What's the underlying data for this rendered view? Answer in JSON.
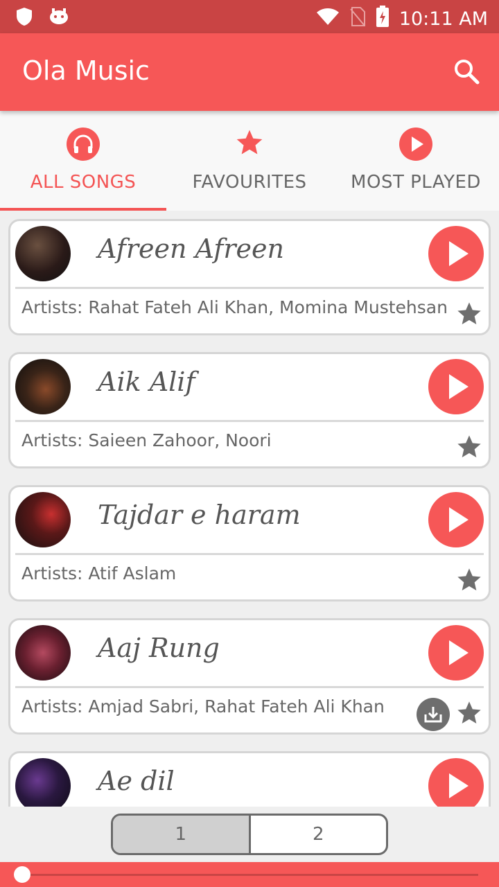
{
  "status": {
    "time": "10:11 AM"
  },
  "app": {
    "title": "Ola Music"
  },
  "tabs": [
    {
      "label": "ALL SONGS",
      "icon": "headphones-icon",
      "active": true
    },
    {
      "label": "FAVOURITES",
      "icon": "star-icon",
      "active": false
    },
    {
      "label": "MOST PLAYED",
      "icon": "play-circle-icon",
      "active": false
    }
  ],
  "songs": [
    {
      "title": "Afreen Afreen",
      "artists": "Artists: Rahat Fateh Ali Khan, Momina Mustehsan",
      "downloadable": false
    },
    {
      "title": "Aik Alif",
      "artists": "Artists: Saieen Zahoor, Noori",
      "downloadable": false
    },
    {
      "title": "Tajdar e haram",
      "artists": "Artists: Atif Aslam",
      "downloadable": false
    },
    {
      "title": "Aaj Rung",
      "artists": "Artists: Amjad Sabri,  Rahat Fateh Ali Khan",
      "downloadable": true
    },
    {
      "title": "Ae dil",
      "artists": "",
      "downloadable": false
    }
  ],
  "pager": {
    "pages": [
      "1",
      "2"
    ],
    "selected": "1"
  },
  "player": {
    "progress": 0.0
  },
  "colors": {
    "accent": "#f65757",
    "statusbar": "#c94444"
  }
}
